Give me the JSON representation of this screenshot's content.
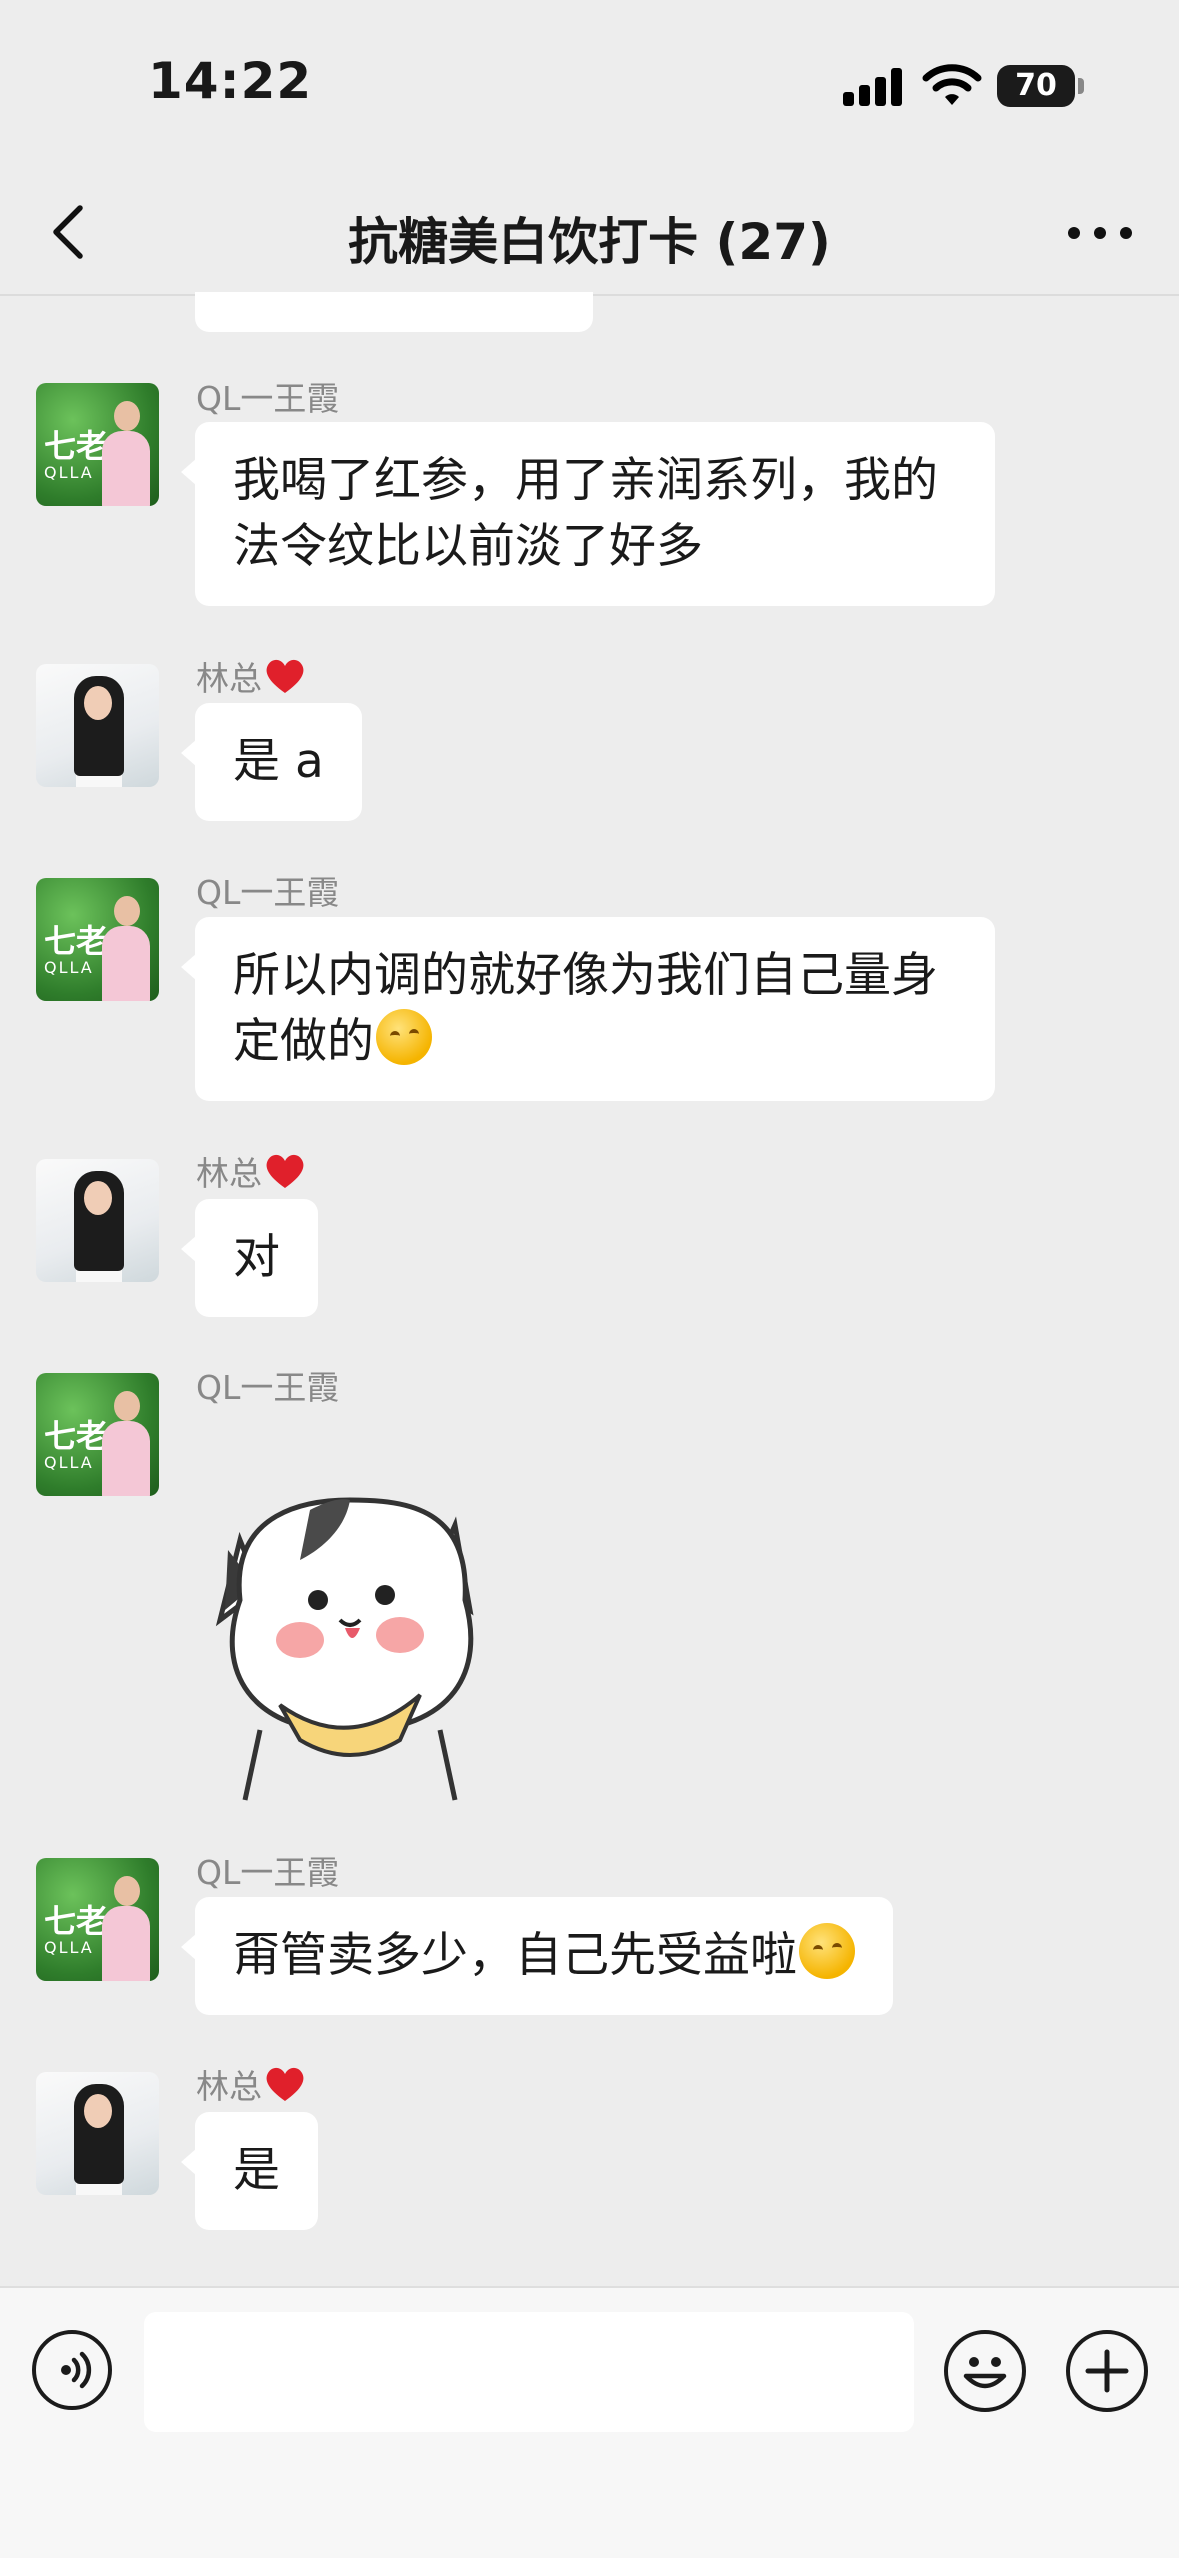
{
  "status_bar": {
    "time": "14:22",
    "battery": "70"
  },
  "header": {
    "title": "抗糖美白饮打卡 (27)"
  },
  "messages": [
    {
      "sender": "QL一王霞",
      "text": "我喝了红参，用了亲润系列，我的法令纹比以前淡了好多"
    },
    {
      "sender": "林总",
      "text": "是 a"
    },
    {
      "sender": "QL一王霞",
      "text": "所以内调的就好像为我们自己量身定做的"
    },
    {
      "sender": "林总",
      "text": "对"
    },
    {
      "sender": "QL一王霞",
      "text": ""
    },
    {
      "sender": "QL一王霞",
      "text": "甭管卖多少，自己先受益啦"
    },
    {
      "sender": "林总",
      "text": "是"
    }
  ],
  "avatars": {
    "brand_logo": "七老",
    "brand_sub": "QLLA"
  },
  "icons": {
    "back": "chevron-left-icon",
    "more": "more-dots-icon",
    "heart": "red-heart-icon",
    "emoji": "thinking-face-icon",
    "voice": "voice-input-icon",
    "sticker_button": "smiley-icon",
    "plus": "plus-icon"
  },
  "colors": {
    "background": "#ededed",
    "bubble": "#ffffff",
    "heart": "#e0202b"
  }
}
